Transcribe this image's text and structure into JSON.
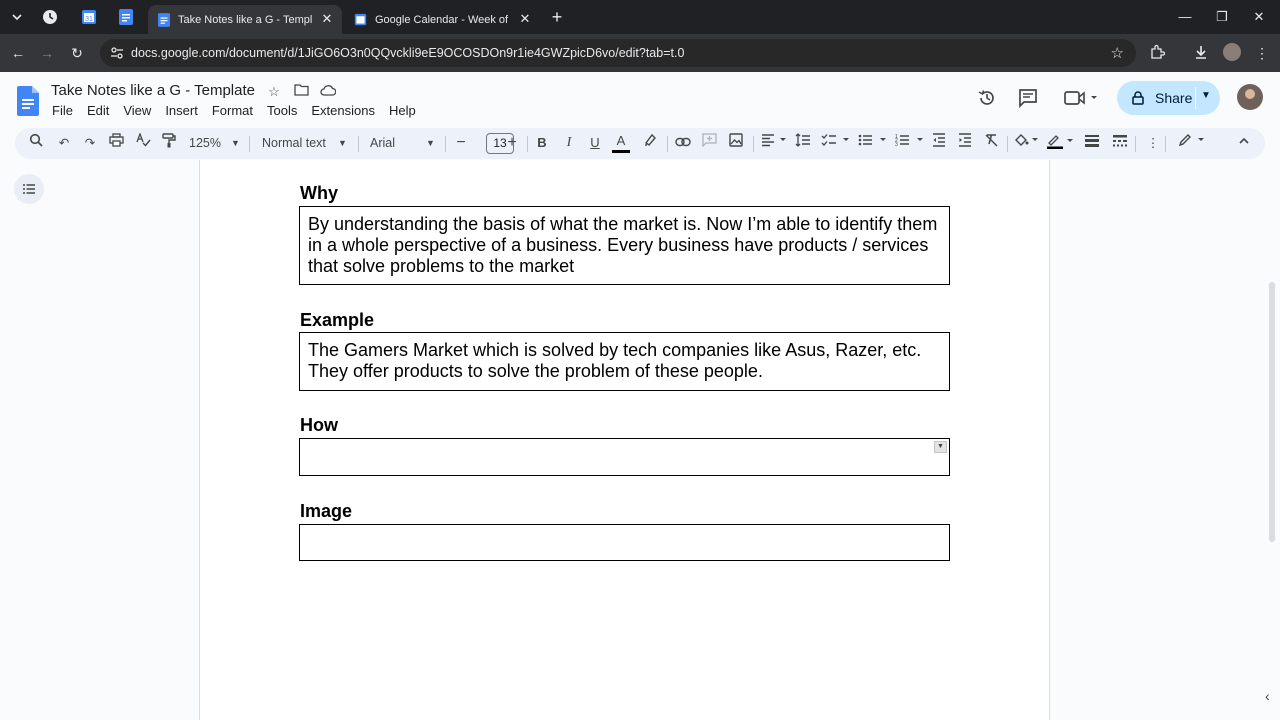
{
  "browser": {
    "tabs": [
      {
        "title": "Take Notes like a G - Template",
        "active": true
      },
      {
        "title": "Google Calendar - Week of Oct",
        "active": false
      }
    ],
    "url": "docs.google.com/document/d/1JiGO6O3n0QQvckli9eE9OCOSDOn9r1ie4GWZpicD6vo/edit?tab=t.0",
    "new_tab": "+",
    "close": "✕"
  },
  "docs": {
    "title": "Take Notes like a G - Template",
    "menu": [
      "File",
      "Edit",
      "View",
      "Insert",
      "Format",
      "Tools",
      "Extensions",
      "Help"
    ],
    "share_label": "Share"
  },
  "toolbar": {
    "zoom": "125%",
    "style": "Normal text",
    "font": "Arial",
    "font_size": "13",
    "bold": "B",
    "italic": "I",
    "underline": "U",
    "text_color": "A"
  },
  "document": {
    "sections": [
      {
        "heading": "Why",
        "body": "By understanding the basis of what the market is. Now I’m able to identify them in a whole perspective of a business. Every business have products / services that solve problems to the market"
      },
      {
        "heading": "Example",
        "body": "The Gamers Market which is solved by tech companies like Asus, Razer, etc. They offer products to solve the problem of these people."
      },
      {
        "heading": "How",
        "body": ""
      },
      {
        "heading": "Image",
        "body": ""
      }
    ]
  },
  "colors": {
    "chrome_dark": "#202124",
    "share_bg": "#c2e7ff",
    "docs_blue": "#4285f4",
    "toolbar_bg": "#edf2fa"
  }
}
